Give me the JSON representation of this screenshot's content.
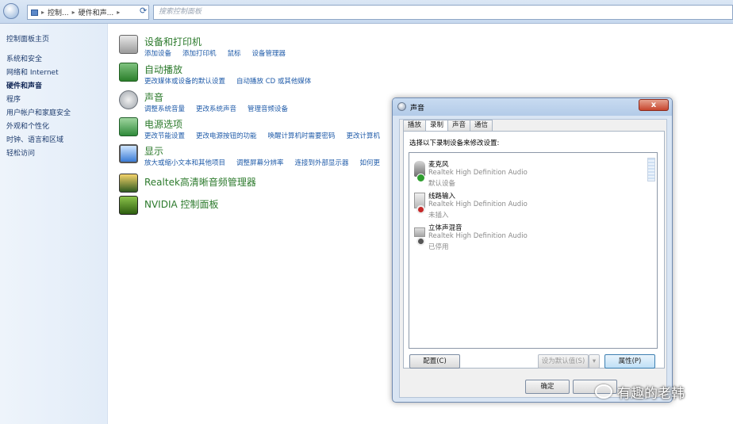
{
  "addressbar": {
    "crumb1": "控制...",
    "crumb2": "硬件和声...",
    "search_placeholder": "搜索控制面板"
  },
  "sidebar": {
    "home": "控制面板主页",
    "items": [
      "系统和安全",
      "网络和 Internet",
      "硬件和声音",
      "程序",
      "用户帐户和家庭安全",
      "外观和个性化",
      "时钟、语言和区域",
      "轻松访问"
    ]
  },
  "categories": [
    {
      "title": "设备和打印机",
      "links": [
        "添加设备",
        "添加打印机",
        "鼠标",
        "设备管理器"
      ]
    },
    {
      "title": "自动播放",
      "links": [
        "更改媒体或设备的默认设置",
        "自动播放 CD 或其他媒体"
      ]
    },
    {
      "title": "声音",
      "links": [
        "调整系统音量",
        "更改系统声音",
        "管理音频设备"
      ]
    },
    {
      "title": "电源选项",
      "links": [
        "更改节能设置",
        "更改电源按钮的功能",
        "唤醒计算机时需要密码",
        "更改计算机"
      ]
    },
    {
      "title": "显示",
      "links": [
        "放大或缩小文本和其他项目",
        "调整屏幕分辨率",
        "连接到外部显示器",
        "如何更"
      ]
    },
    {
      "title": "Realtek高清晰音频管理器",
      "links": []
    },
    {
      "title": "NVIDIA 控制面板",
      "links": []
    }
  ],
  "dialog": {
    "title": "声音",
    "close": "x",
    "tabs": [
      "播放",
      "录制",
      "声音",
      "通信"
    ],
    "instruction": "选择以下录制设备来修改设置:",
    "devices": [
      {
        "name": "麦克风",
        "driver": "Realtek High Definition Audio",
        "status": "默认设备"
      },
      {
        "name": "线路输入",
        "driver": "Realtek High Definition Audio",
        "status": "未插入"
      },
      {
        "name": "立体声混音",
        "driver": "Realtek High Definition Audio",
        "status": "已停用"
      }
    ],
    "buttons": {
      "configure": "配置(C)",
      "set_default": "设为默认值(S)",
      "properties": "属性(P)",
      "ok": "确定"
    }
  },
  "watermark": "有趣的老韩"
}
